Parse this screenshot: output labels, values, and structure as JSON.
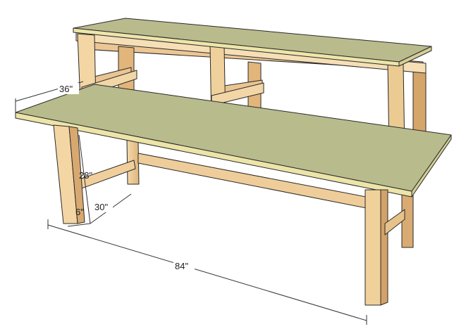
{
  "dimensions": {
    "depth_upper": "36\"",
    "height": "28\"",
    "depth_lower": "30\"",
    "leg_inset": "6\"",
    "length": "84\""
  },
  "colors": {
    "background": "#ffffff",
    "top_surface": "#b8bb8c",
    "top_edge": "#ece4a8",
    "wood_light": "#f2d3a2",
    "wood_mid": "#e6bf86",
    "wood_dark": "#c99c62",
    "outline": "#2a2a2a",
    "dimension_line": "#333333"
  }
}
